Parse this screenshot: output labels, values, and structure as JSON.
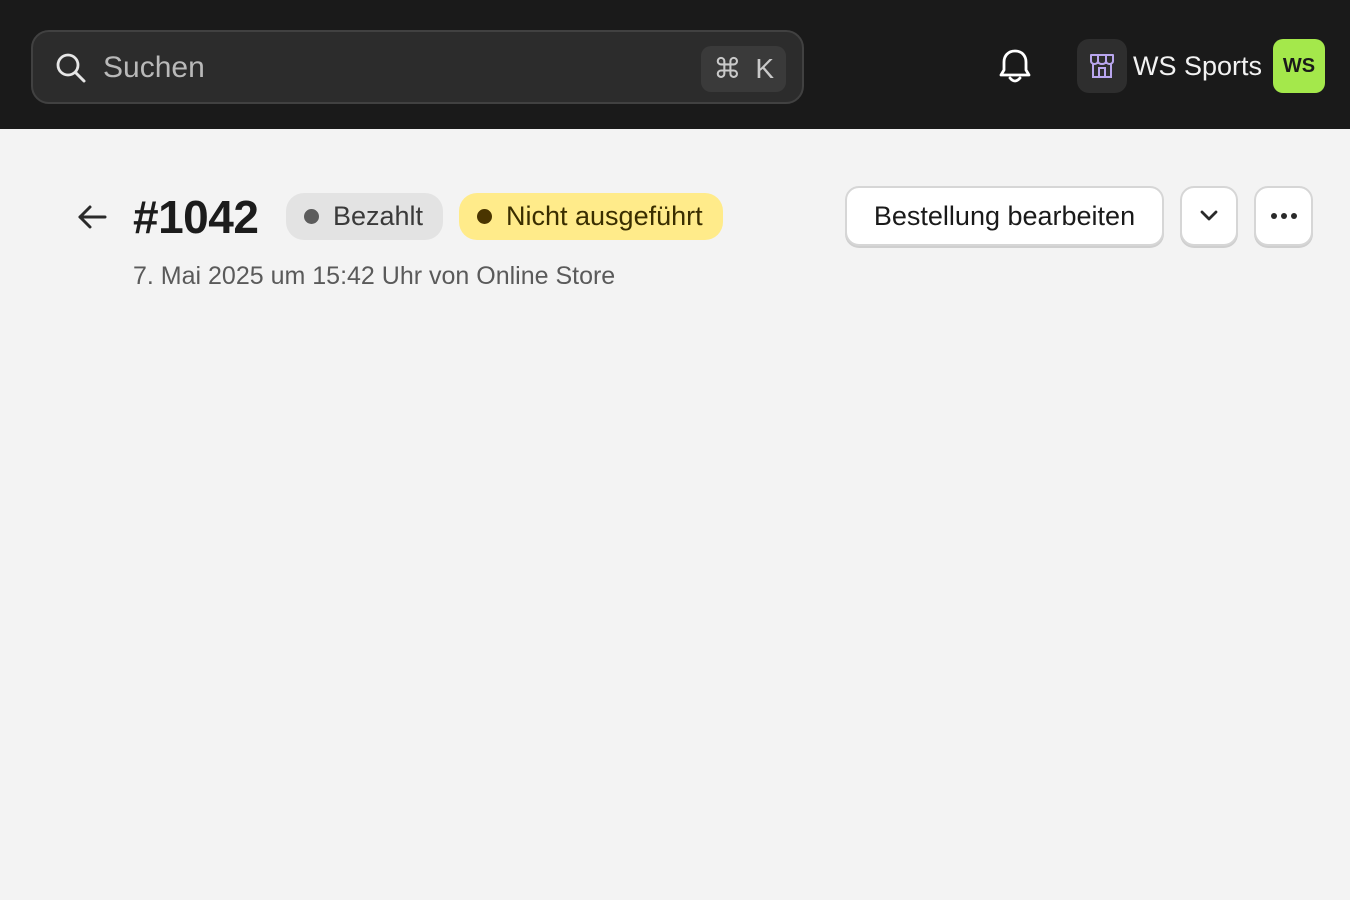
{
  "topbar": {
    "search": {
      "placeholder": "Suchen",
      "shortcut_symbol": "⌘",
      "shortcut_key": "K"
    },
    "notifications_icon": "bell-icon",
    "store": {
      "name": "WS Sports",
      "icon": "store-icon",
      "avatar_initials": "WS",
      "avatar_color": "#a4e84b"
    }
  },
  "order": {
    "id": "#1042",
    "badges": [
      {
        "label": "Bezahlt",
        "color": "#e3e3e3"
      },
      {
        "label": "Nicht ausgeführt",
        "color": "#ffeb8a"
      }
    ],
    "subtitle": "7. Mai 2025 um 15:42 Uhr von Online Store",
    "actions": {
      "edit_label": "Bestellung bearbeiten",
      "dropdown_icon": "chevron-down-icon",
      "more_icon": "more-horizontal-icon"
    }
  }
}
